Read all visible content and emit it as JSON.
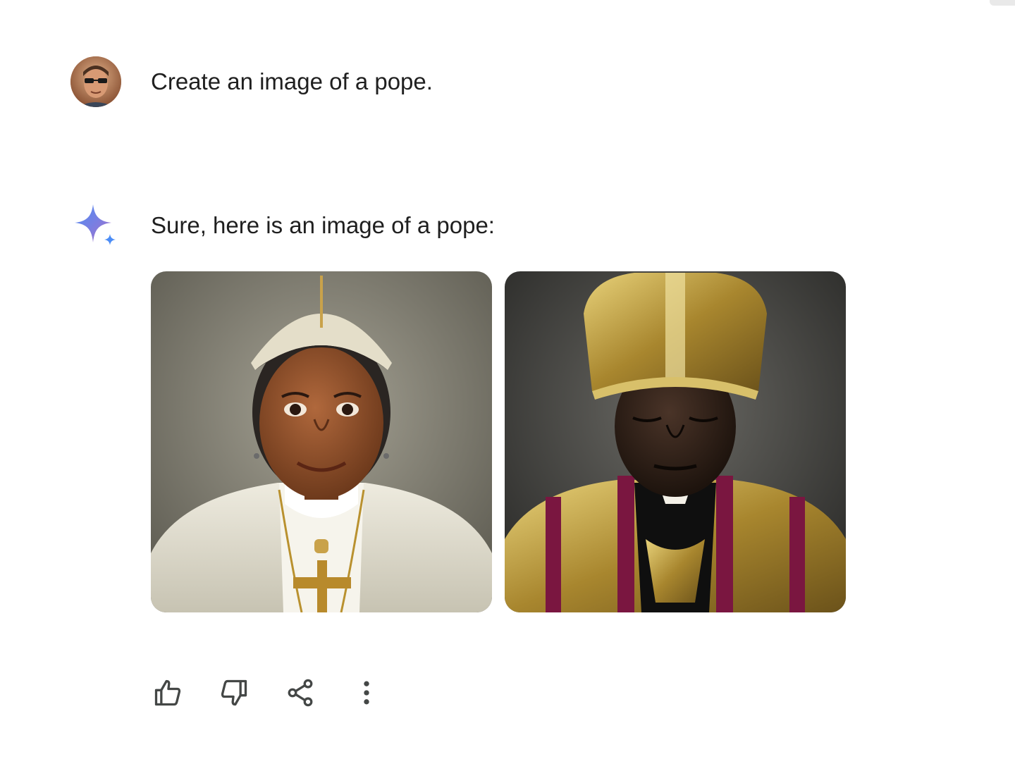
{
  "user_turn": {
    "avatar_icon": "user-avatar",
    "prompt": "Create an image of a pope."
  },
  "model_turn": {
    "icon": "gemini-spark-icon",
    "response": "Sure, here is an image of a pope:",
    "images": [
      {
        "icon": "generated-portrait-white-vestments"
      },
      {
        "icon": "generated-portrait-gold-vestments"
      }
    ]
  },
  "actions": [
    {
      "icon": "thumbs-up-icon"
    },
    {
      "icon": "thumbs-down-icon"
    },
    {
      "icon": "share-icon"
    },
    {
      "icon": "more-vert-icon"
    }
  ],
  "colors": {
    "text": "#1f1f1f",
    "icon": "#444746",
    "spark_blue": "#4c8df6",
    "spark_purple": "#9b72cb"
  }
}
